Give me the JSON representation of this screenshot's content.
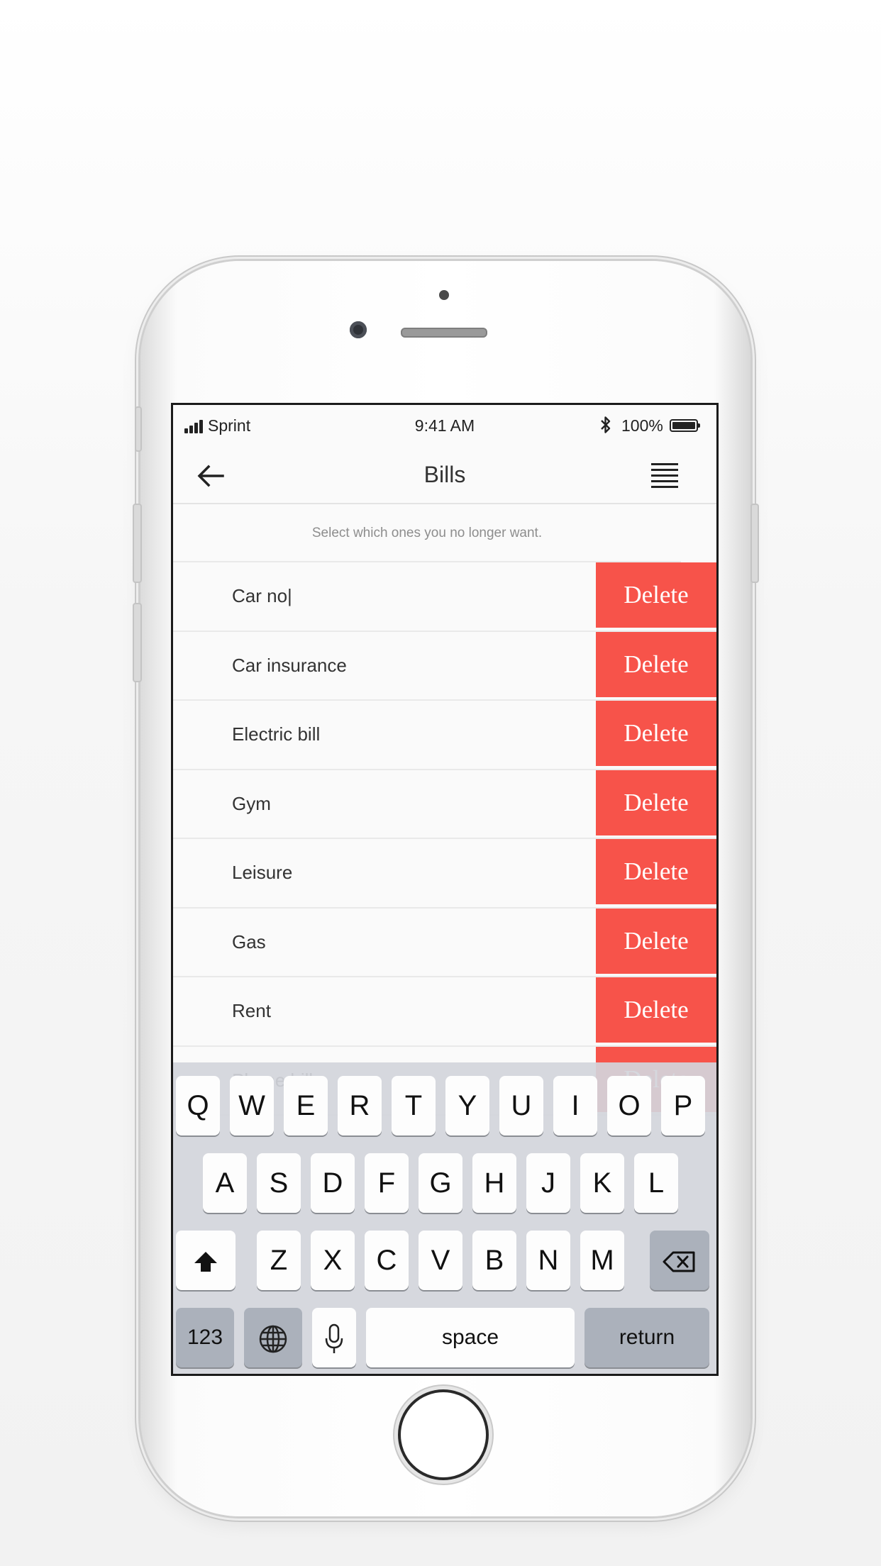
{
  "status_bar": {
    "carrier": "Sprint",
    "time": "9:41 AM",
    "battery": "100%"
  },
  "nav": {
    "title": "Bills"
  },
  "instruction": "Select which ones you no longer want.",
  "bills": [
    {
      "label": "Car no",
      "delete": "Delete"
    },
    {
      "label": "Car insurance",
      "delete": "Delete"
    },
    {
      "label": "Electric bill",
      "delete": "Delete"
    },
    {
      "label": "Gym",
      "delete": "Delete"
    },
    {
      "label": "Leisure",
      "delete": "Delete"
    },
    {
      "label": "Gas",
      "delete": "Delete"
    },
    {
      "label": "Rent",
      "delete": "Delete"
    },
    {
      "label": "Phone bill",
      "delete": "Delete"
    }
  ],
  "keyboard": {
    "row1": [
      "Q",
      "W",
      "E",
      "R",
      "T",
      "Y",
      "U",
      "I",
      "O",
      "P"
    ],
    "row2": [
      "A",
      "S",
      "D",
      "F",
      "G",
      "H",
      "J",
      "K",
      "L"
    ],
    "row3": [
      "Z",
      "X",
      "C",
      "V",
      "B",
      "N",
      "M"
    ],
    "numbers_label": "123",
    "space_label": "space",
    "return_label": "return"
  },
  "colors": {
    "delete_red": "#f7534a",
    "keyboard_bg": "#d2d5db",
    "key_dark": "#abb1bb"
  }
}
